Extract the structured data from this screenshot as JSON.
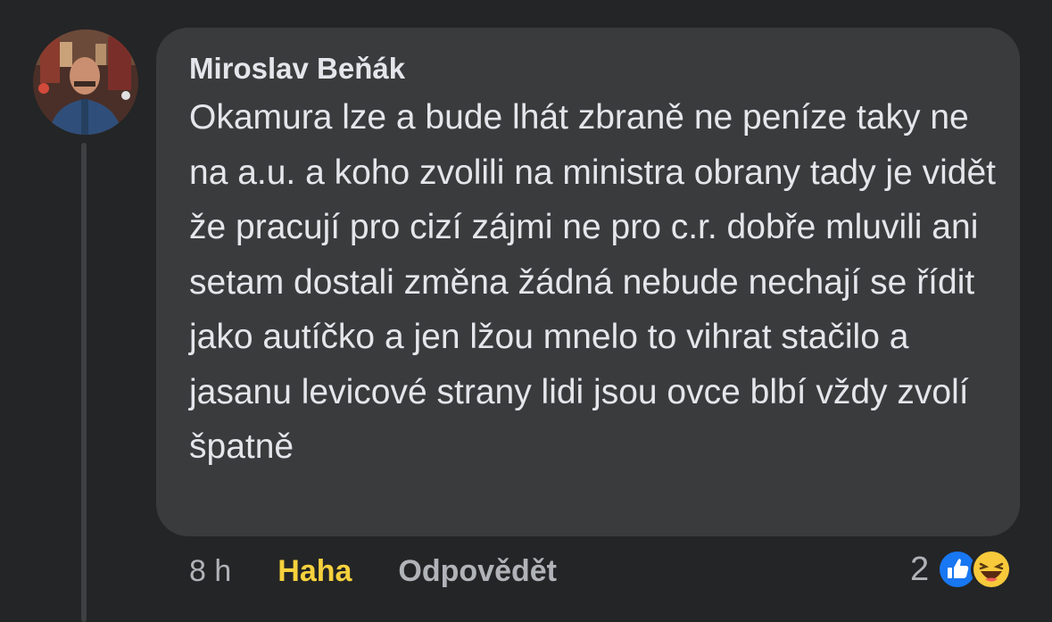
{
  "comment": {
    "author": "Miroslav Beňák",
    "text": "Okamura lze a bude lhát zbraně ne peníze taky ne na a.u. a koho zvolili na ministra obrany tady je vidět že pracují pro cizí zájmi ne pro c.r. dobře mluvili ani setam dostali změna žádná nebude nechají se řídit jako autíčko a jen lžou mnelo to vihrat stačilo a jasanu levicové strany lidi jsou ovce blbí vždy zvolí špatně",
    "time": "8 h",
    "reaction_label": "Haha",
    "reply_label": "Odpovědět",
    "reaction_count": "2",
    "reaction_icons": [
      "like-icon",
      "haha-icon"
    ]
  },
  "colors": {
    "background": "#242526",
    "bubble": "#3a3b3c",
    "text": "#e4e6eb",
    "secondary_text": "#b0b3b8",
    "haha_yellow": "#f7d13d",
    "like_blue": "#1877f2"
  }
}
